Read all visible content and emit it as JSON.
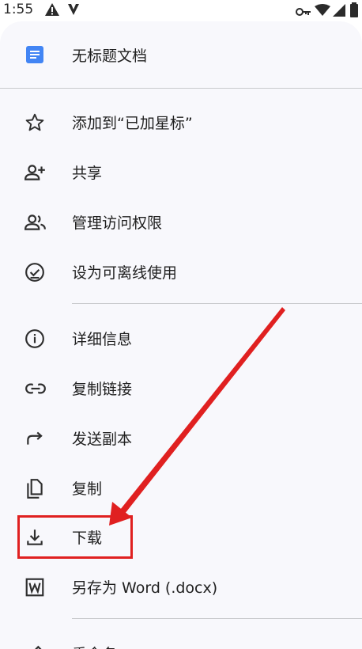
{
  "status_bar": {
    "time": "1:55",
    "icons": [
      "warning-icon",
      "v-notification-icon",
      "vpn-key-icon",
      "wifi-icon",
      "signal-icon",
      "battery-icon"
    ]
  },
  "document": {
    "title": "无标题文档",
    "icon": "google-docs-icon",
    "accent_color": "#4285f4"
  },
  "menu": {
    "star": "添加到“已加星标”",
    "share": "共享",
    "manage_access": "管理访问权限",
    "offline": "设为可离线使用",
    "details": "详细信息",
    "copy_link": "复制链接",
    "send_copy": "发送副本",
    "copy": "复制",
    "download": "下载",
    "save_as_word": "另存为 Word (.docx)",
    "rename": "重命名"
  },
  "annotation": {
    "highlight_color": "#e02020",
    "highlighted_item": "下载"
  }
}
